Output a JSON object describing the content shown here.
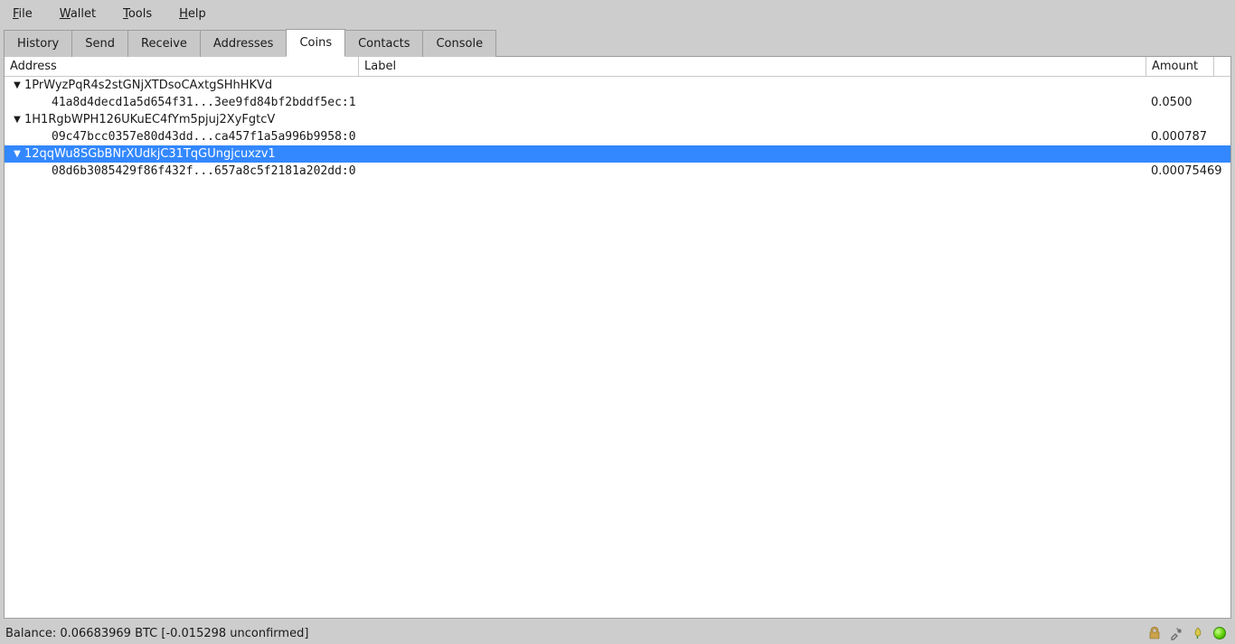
{
  "menu": {
    "file": "File",
    "wallet": "Wallet",
    "tools": "Tools",
    "help": "Help"
  },
  "tabs": {
    "history": "History",
    "send": "Send",
    "receive": "Receive",
    "addresses": "Addresses",
    "coins": "Coins",
    "contacts": "Contacts",
    "console": "Console"
  },
  "columns": {
    "address": "Address",
    "label": "Label",
    "amount": "Amount"
  },
  "entries": [
    {
      "address": "1PrWyzPqR4s2stGNjXTDsoCAxtgSHhHKVd",
      "txid": "41a8d4decd1a5d654f31...3ee9fd84bf2bddf5ec:1",
      "amount": "0.0500",
      "selected": false
    },
    {
      "address": "1H1RgbWPH126UKuEC4fYm5pjuj2XyFgtcV",
      "txid": "09c47bcc0357e80d43dd...ca457f1a5a996b9958:0",
      "amount": "0.000787",
      "selected": false
    },
    {
      "address": "12qqWu8SGbBNrXUdkjC31TqGUngjcuxzv1",
      "txid": "08d6b3085429f86f432f...657a8c5f2181a202dd:0",
      "amount": "0.00075469",
      "selected": true
    }
  ],
  "status": {
    "balance_text": "Balance: 0.06683969 BTC  [-0.015298 unconfirmed]"
  },
  "icons": {
    "lock": "lock-icon",
    "tools": "tools-icon",
    "seed": "seed-icon",
    "network": "network-led"
  }
}
